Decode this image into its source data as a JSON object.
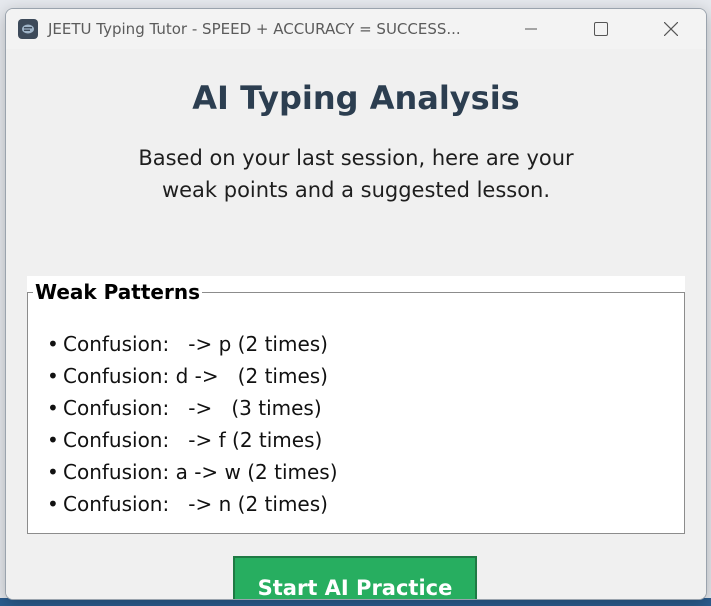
{
  "window": {
    "title": "JEETU Typing Tutor - SPEED + ACCURACY = SUCCESS...",
    "controls": {
      "minimize": "minimize-icon",
      "maximize": "maximize-icon",
      "close": "close-icon"
    }
  },
  "main": {
    "heading": "AI Typing Analysis",
    "subtitle_line1": "Based on your last session, here are your",
    "subtitle_line2": "weak points and a suggested lesson."
  },
  "weak_patterns": {
    "label": "Weak Patterns",
    "items": [
      {
        "text": "Confusion:   -> p (2 times)"
      },
      {
        "text": "Confusion: d ->   (2 times)"
      },
      {
        "text": "Confusion:   ->   (3 times)"
      },
      {
        "text": "Confusion:   -> f (2 times)"
      },
      {
        "text": "Confusion: a -> w (2 times)"
      },
      {
        "text": "Confusion:   -> n (2 times)"
      }
    ]
  },
  "actions": {
    "start_label": "Start AI Practice"
  },
  "colors": {
    "accent": "#27ae60",
    "heading": "#2c3e50"
  }
}
